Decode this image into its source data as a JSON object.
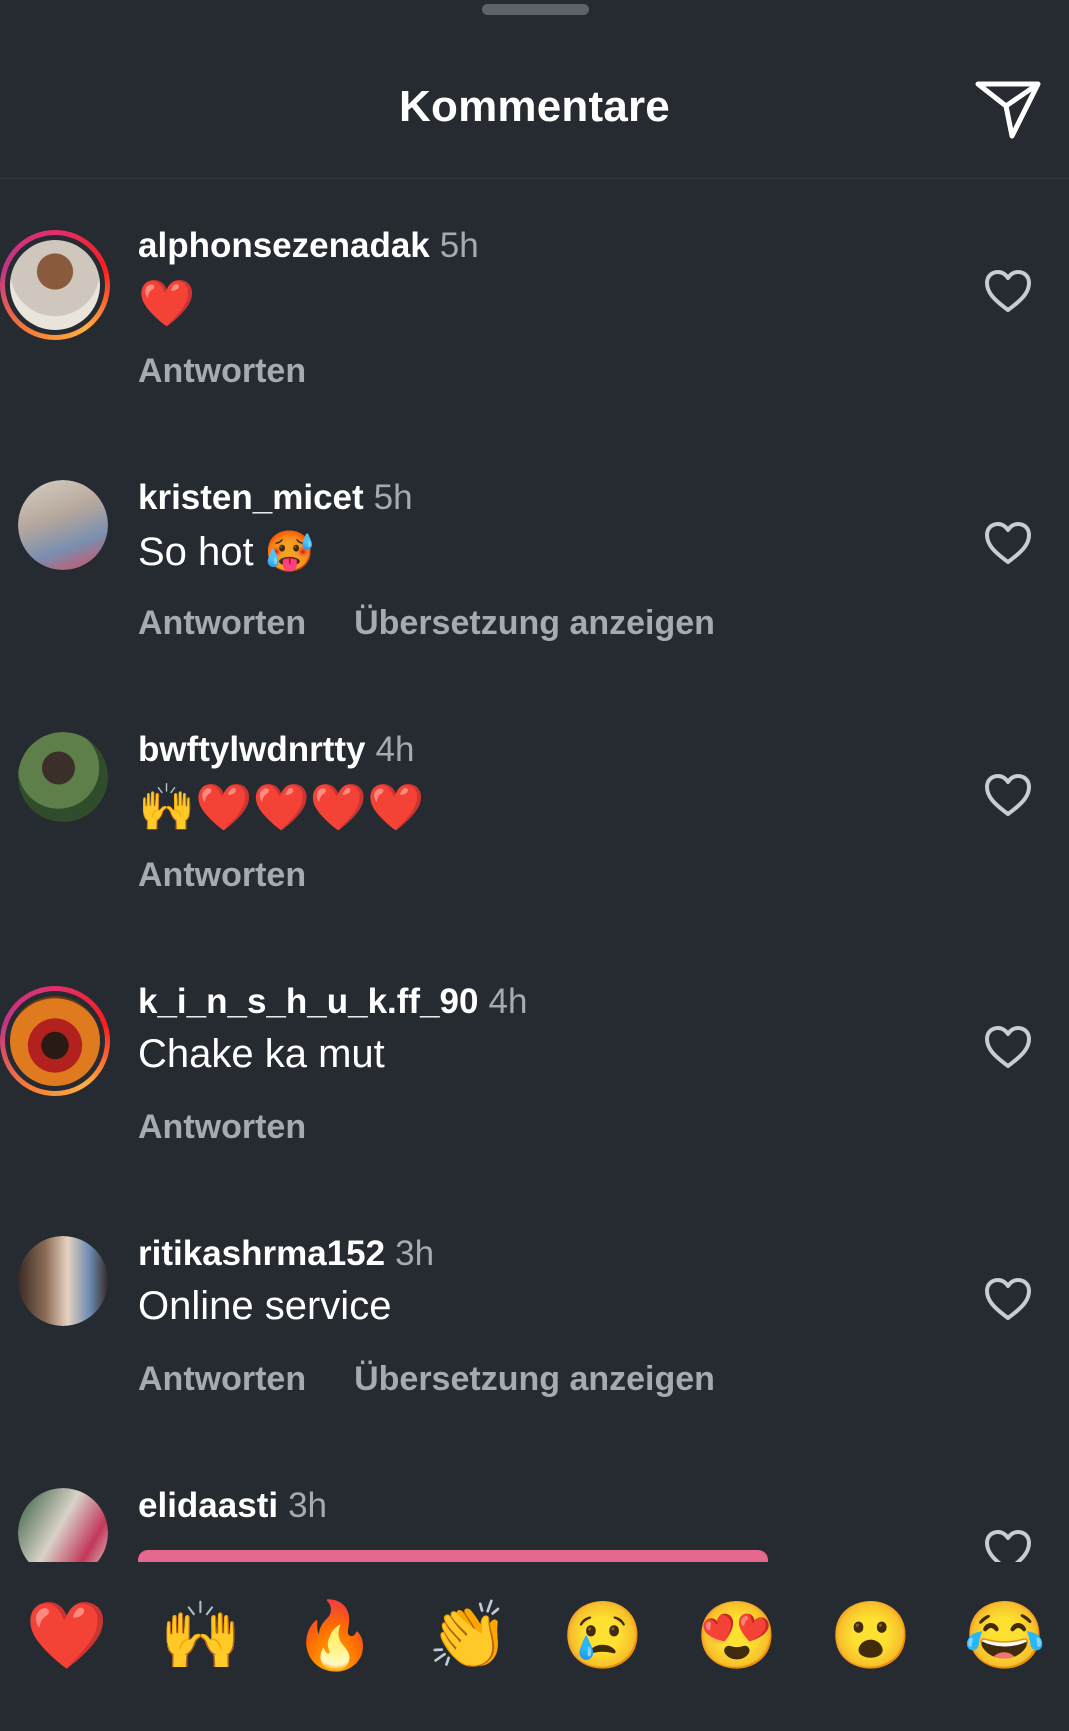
{
  "header": {
    "title": "Kommentare"
  },
  "comments": [
    {
      "username": "alphonsezenadak",
      "time": "5h",
      "text": "❤️",
      "reply": "Antworten",
      "translate": "",
      "ring": true
    },
    {
      "username": "kristen_micet",
      "time": "5h",
      "text": "So hot 🥵",
      "reply": "Antworten",
      "translate": "Übersetzung anzeigen",
      "ring": false
    },
    {
      "username": "bwftylwdnrtty",
      "time": "4h",
      "text": "🙌❤️❤️❤️❤️",
      "reply": "Antworten",
      "translate": "",
      "ring": false
    },
    {
      "username": "k_i_n_s_h_u_k.ff_90",
      "time": "4h",
      "text": "Chake ka mut",
      "reply": "Antworten",
      "translate": "",
      "ring": true
    },
    {
      "username": "ritikashrma152",
      "time": "3h",
      "text": "Online service",
      "reply": "Antworten",
      "translate": "Übersetzung anzeigen",
      "ring": false
    },
    {
      "username": "elidaasti",
      "time": "3h",
      "text": "",
      "reply": "",
      "translate": "",
      "ring": false
    }
  ],
  "reaction_bar": [
    "❤️",
    "🙌",
    "🔥",
    "👏",
    "😢",
    "😍",
    "😮",
    "😂"
  ],
  "icons": {
    "send": "send-icon",
    "like": "heart-outline-icon"
  },
  "colors": {
    "background": "#262a31",
    "secondary_text": "#a7abb1",
    "pink": "#e5688f"
  }
}
